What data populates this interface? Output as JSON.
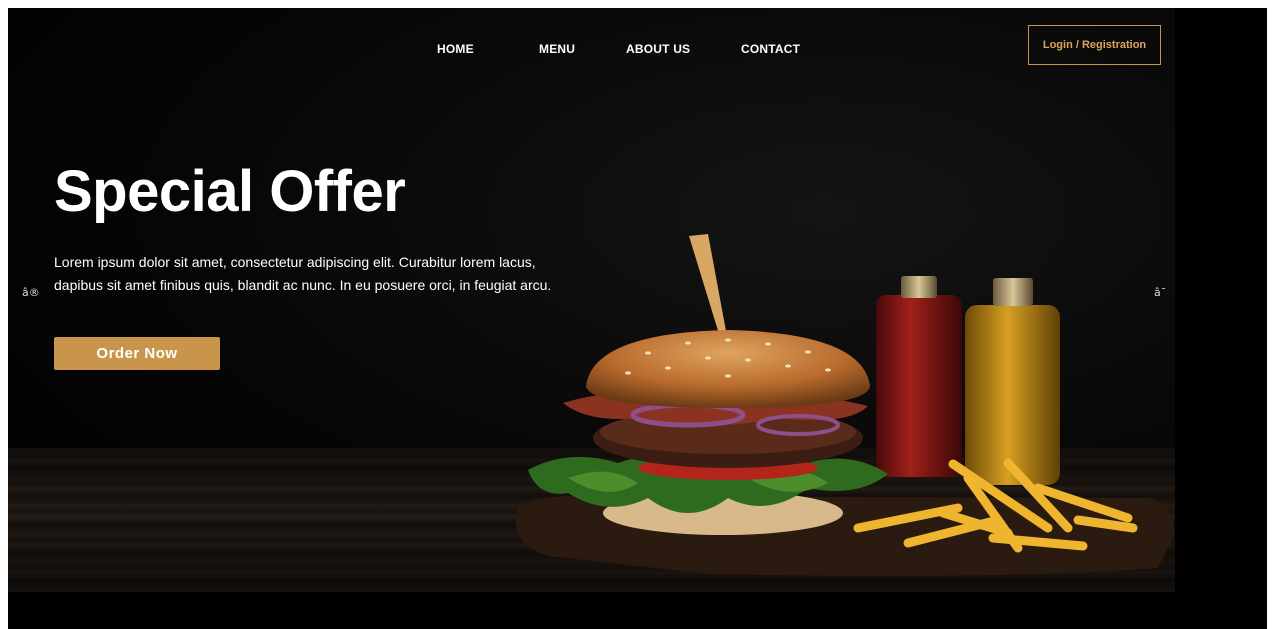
{
  "nav": {
    "items": [
      {
        "label": "HOME"
      },
      {
        "label": "MENU"
      },
      {
        "label": "ABOUT US"
      },
      {
        "label": "CONTACT"
      }
    ],
    "login_label": "Login / Registration"
  },
  "hero": {
    "title": "Special Offer",
    "description": "Lorem ipsum dolor sit amet, consectetur adipiscing elit. Curabitur lorem lacus, dapibus sit amet finibus quis, blandit ac nunc. In eu posuere orci, in feugiat arcu.",
    "order_label": "Order Now",
    "image_subject": "burger-with-fries-and-sauce-bottles"
  },
  "slider": {
    "prev_label": "â®",
    "next_label": "â¯"
  },
  "colors": {
    "accent": "#c8954a",
    "background": "#000000",
    "text": "#ffffff"
  }
}
